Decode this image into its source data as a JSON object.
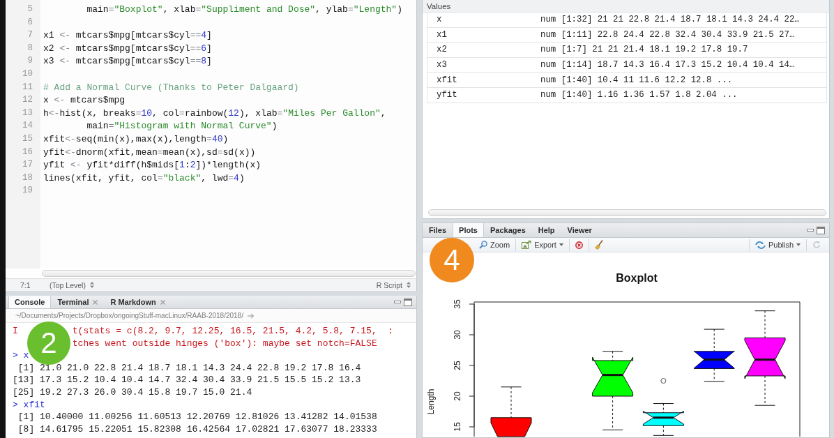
{
  "editor": {
    "lines": [
      {
        "number": "5",
        "tokens": [
          {
            "kind": "plain",
            "text": "        main"
          },
          {
            "kind": "op",
            "text": "="
          },
          {
            "kind": "str",
            "text": "\"Boxplot\""
          },
          {
            "kind": "plain",
            "text": ", xlab"
          },
          {
            "kind": "op",
            "text": "="
          },
          {
            "kind": "str",
            "text": "\"Suppliment and Dose\""
          },
          {
            "kind": "plain",
            "text": ", ylab"
          },
          {
            "kind": "op",
            "text": "="
          },
          {
            "kind": "str",
            "text": "\"Length\""
          },
          {
            "kind": "plain",
            "text": ")"
          }
        ]
      },
      {
        "number": "6"
      },
      {
        "number": "7",
        "tokens": [
          {
            "kind": "plain",
            "text": "x1 "
          },
          {
            "kind": "op",
            "text": "<-"
          },
          {
            "kind": "plain",
            "text": " mtcars$mpg[mtcars$cyl"
          },
          {
            "kind": "op",
            "text": "=="
          },
          {
            "kind": "num",
            "text": "4"
          },
          {
            "kind": "plain",
            "text": "]"
          }
        ]
      },
      {
        "number": "8",
        "tokens": [
          {
            "kind": "plain",
            "text": "x2 "
          },
          {
            "kind": "op",
            "text": "<-"
          },
          {
            "kind": "plain",
            "text": " mtcars$mpg[mtcars$cyl"
          },
          {
            "kind": "op",
            "text": "=="
          },
          {
            "kind": "num",
            "text": "6"
          },
          {
            "kind": "plain",
            "text": "]"
          }
        ]
      },
      {
        "number": "9",
        "tokens": [
          {
            "kind": "plain",
            "text": "x3 "
          },
          {
            "kind": "op",
            "text": "<-"
          },
          {
            "kind": "plain",
            "text": " mtcars$mpg[mtcars$cyl"
          },
          {
            "kind": "op",
            "text": "=="
          },
          {
            "kind": "num",
            "text": "8"
          },
          {
            "kind": "plain",
            "text": "]"
          }
        ]
      },
      {
        "number": "10"
      },
      {
        "number": "11",
        "tokens": [
          {
            "kind": "comment",
            "text": "# Add a Normal Curve (Thanks to Peter Dalgaard)"
          }
        ]
      },
      {
        "number": "12",
        "tokens": [
          {
            "kind": "plain",
            "text": "x "
          },
          {
            "kind": "op",
            "text": "<-"
          },
          {
            "kind": "plain",
            "text": " mtcars$mpg"
          }
        ]
      },
      {
        "number": "13",
        "tokens": [
          {
            "kind": "plain",
            "text": "h"
          },
          {
            "kind": "op",
            "text": "<-"
          },
          {
            "kind": "plain",
            "text": "hist(x, breaks"
          },
          {
            "kind": "op",
            "text": "="
          },
          {
            "kind": "num",
            "text": "10"
          },
          {
            "kind": "plain",
            "text": ", col"
          },
          {
            "kind": "op",
            "text": "="
          },
          {
            "kind": "plain",
            "text": "rainbow("
          },
          {
            "kind": "num",
            "text": "12"
          },
          {
            "kind": "plain",
            "text": "), xlab"
          },
          {
            "kind": "op",
            "text": "="
          },
          {
            "kind": "str",
            "text": "\"Miles Per Gallon\""
          },
          {
            "kind": "plain",
            "text": ","
          }
        ]
      },
      {
        "number": "14",
        "tokens": [
          {
            "kind": "plain",
            "text": "        main"
          },
          {
            "kind": "op",
            "text": "="
          },
          {
            "kind": "str",
            "text": "\"Histogram with Normal Curve\""
          },
          {
            "kind": "plain",
            "text": ")"
          }
        ]
      },
      {
        "number": "15",
        "tokens": [
          {
            "kind": "plain",
            "text": "xfit"
          },
          {
            "kind": "op",
            "text": "<-"
          },
          {
            "kind": "plain",
            "text": "seq(min(x),max(x),length"
          },
          {
            "kind": "op",
            "text": "="
          },
          {
            "kind": "num",
            "text": "40"
          },
          {
            "kind": "plain",
            "text": ")"
          }
        ]
      },
      {
        "number": "16",
        "tokens": [
          {
            "kind": "plain",
            "text": "yfit"
          },
          {
            "kind": "op",
            "text": "<-"
          },
          {
            "kind": "plain",
            "text": "dnorm(xfit,mean"
          },
          {
            "kind": "op",
            "text": "="
          },
          {
            "kind": "plain",
            "text": "mean(x),sd"
          },
          {
            "kind": "op",
            "text": "="
          },
          {
            "kind": "plain",
            "text": "sd(x))"
          }
        ]
      },
      {
        "number": "17",
        "tokens": [
          {
            "kind": "plain",
            "text": "yfit "
          },
          {
            "kind": "op",
            "text": "<-"
          },
          {
            "kind": "plain",
            "text": " yfit*diff(h$mids["
          },
          {
            "kind": "num",
            "text": "1"
          },
          {
            "kind": "plain",
            "text": ":"
          },
          {
            "kind": "num",
            "text": "2"
          },
          {
            "kind": "plain",
            "text": "])*length(x)"
          }
        ]
      },
      {
        "number": "18",
        "tokens": [
          {
            "kind": "plain",
            "text": "lines(xfit, yfit, col"
          },
          {
            "kind": "op",
            "text": "="
          },
          {
            "kind": "str",
            "text": "\"black\""
          },
          {
            "kind": "plain",
            "text": ", lwd"
          },
          {
            "kind": "op",
            "text": "="
          },
          {
            "kind": "num",
            "text": "4"
          },
          {
            "kind": "plain",
            "text": ")"
          }
        ]
      },
      {
        "number": "19"
      }
    ],
    "status_bar": {
      "position": "7:1",
      "scope": "(Top Level)",
      "file_type": "R Script"
    }
  },
  "console": {
    "tabs": [
      {
        "label": "Console",
        "selected": true,
        "closable": false
      },
      {
        "label": "Terminal",
        "selected": false,
        "closable": true
      },
      {
        "label": "R Markdown",
        "selected": false,
        "closable": true
      }
    ],
    "path": "~/Documents/Projects/Dropbox/ongoingStuff-macLinux/RAAB-2018/2018/",
    "lines": [
      {
        "kind": "error",
        "covered": true,
        "lead": "I",
        "text": "t(stats = c(8.2, 9.7, 12.25, 16.5, 21.5, 4.2, 5.8, 7.15,  :"
      },
      {
        "kind": "error",
        "covered": true,
        "text": "tches went outside hinges ('box'): maybe set notch=FALSE"
      },
      {
        "kind": "prompt",
        "covered": false,
        "text": "> x"
      },
      {
        "kind": "output",
        "covered": false,
        "text": " [1] 21.0 21.0 22.8 21.4 18.7 18.1 14.3 24.4 22.8 19.2 17.8 16.4"
      },
      {
        "kind": "output",
        "covered": false,
        "text": "[13] 17.3 15.2 10.4 10.4 14.7 32.4 30.4 33.9 21.5 15.5 15.2 13.3"
      },
      {
        "kind": "output",
        "covered": false,
        "text": "[25] 19.2 27.3 26.0 30.4 15.8 19.7 15.0 21.4"
      },
      {
        "kind": "prompt",
        "covered": false,
        "text": "> xfit"
      },
      {
        "kind": "output",
        "covered": false,
        "text": " [1] 10.40000 11.00256 11.60513 12.20769 12.81026 13.41282 14.01538"
      },
      {
        "kind": "output",
        "covered": false,
        "text": " [8] 14.61795 15.22051 15.82308 16.42564 17.02821 17.63077 18.23333"
      }
    ]
  },
  "environment": {
    "section": "Values",
    "rows": [
      {
        "name": "x",
        "value": "num [1:32] 21 21 22.8 21.4 18.7 18.1 14.3 24.4 22…"
      },
      {
        "name": "x1",
        "value": "num [1:11] 22.8 24.4 22.8 32.4 30.4 33.9 21.5 27…"
      },
      {
        "name": "x2",
        "value": "num [1:7] 21 21 21.4 18.1 19.2 17.8 19.7"
      },
      {
        "name": "x3",
        "value": "num [1:14] 18.7 14.3 16.4 17.3 15.2 10.4 10.4 14…"
      },
      {
        "name": "xfit",
        "value": "num [1:40] 10.4 11 11.6 12.2 12.8 ..."
      },
      {
        "name": "yfit",
        "value": "num [1:40] 1.16 1.36 1.57 1.8 2.04 ..."
      }
    ]
  },
  "plots": {
    "tabs": [
      {
        "label": "Files",
        "selected": false
      },
      {
        "label": "Plots",
        "selected": true
      },
      {
        "label": "Packages",
        "selected": false
      },
      {
        "label": "Help",
        "selected": false
      },
      {
        "label": "Viewer",
        "selected": false
      }
    ],
    "toolbar": {
      "left": [
        {
          "kind": "zoom",
          "label": "Zoom",
          "dropdown": false
        },
        {
          "kind": "export",
          "label": "Export",
          "dropdown": true
        },
        {
          "kind": "remove",
          "dropdown": false
        },
        {
          "kind": "clear",
          "dropdown": false
        }
      ],
      "right": [
        {
          "kind": "publish",
          "label": "Publish",
          "dropdown": true
        },
        {
          "kind": "refresh",
          "dropdown": false
        }
      ]
    },
    "plot": {
      "title": "Boxplot",
      "ylabel": "Length",
      "yticks": [
        "15",
        "20",
        "25",
        "30",
        "35"
      ],
      "boxes": [
        {
          "color": "#ff0000"
        },
        {
          "color": "#00ff00"
        },
        {
          "color": "#00ffff"
        },
        {
          "color": "#0000ff"
        },
        {
          "color": "#ff00ff"
        }
      ]
    }
  },
  "callouts": [
    {
      "label": "2",
      "color": "#6abf2e"
    },
    {
      "label": "4",
      "color": "#f0891e"
    }
  ]
}
